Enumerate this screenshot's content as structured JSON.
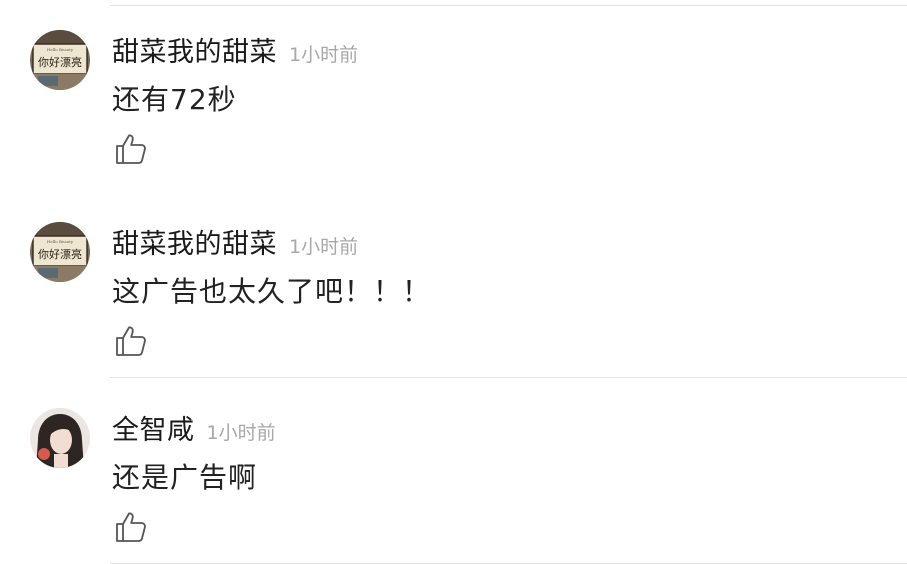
{
  "comments": [
    {
      "username": "甜菜我的甜菜",
      "time": "1小时前",
      "text": "这广告也太久了吧！！！",
      "avatar_text": "你好漂亮",
      "avatar_subtext": "Hello Beauty"
    },
    {
      "username": "全智咸",
      "time": "1小时前",
      "text": "还是广告啊"
    },
    {
      "username": "甜菜我的甜菜",
      "time": "1小时前",
      "text": "还有72秒",
      "avatar_text": "你好漂亮",
      "avatar_subtext": "Hello Beauty"
    }
  ],
  "icons": {
    "like": "thumbs-up-icon"
  },
  "colors": {
    "username": "#1a1a1a",
    "time": "#a8a8a8",
    "text": "#222222",
    "divider": "#e3e3e3",
    "icon": "#555555"
  }
}
